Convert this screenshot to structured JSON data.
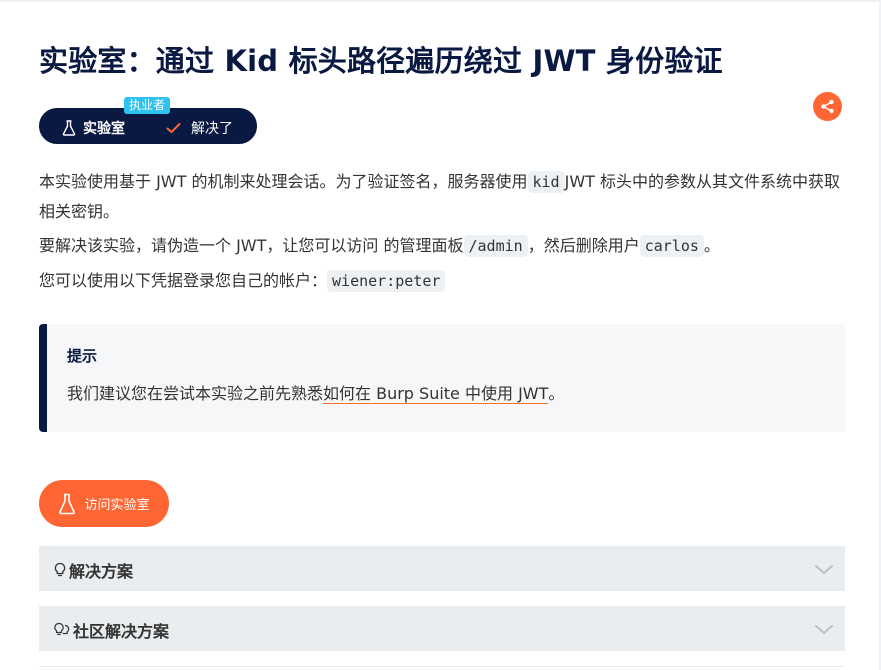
{
  "title": "实验室：通过 Kid 标头路径遍历绕过 JWT 身份验证",
  "status": {
    "tag": "执业者",
    "lab_label": "实验室",
    "solved_label": "解决了"
  },
  "description": {
    "p1_before": "本实验使用基于 JWT 的机制来处理会话。为了验证签名，服务器使用",
    "p1_code": "kid",
    "p1_after": "JWT 标头中的参数从其文件系统中获取相关密钥。",
    "p2_before": "要解决该实验，请伪造一个 JWT，让您可以访问 的管理面板",
    "p2_code1": "/admin",
    "p2_mid": "，然后删除用户",
    "p2_code2": "carlos",
    "p2_after": "。",
    "p3_before": "您可以使用以下凭据登录您自己的帐户：",
    "p3_code": "wiener:peter"
  },
  "hint": {
    "title": "提示",
    "text_before": "我们建议您在尝试本实验之前先熟悉",
    "link": "如何在 Burp Suite 中使用 JWT",
    "text_after": "。"
  },
  "access_button": "访问实验室",
  "accordions": [
    {
      "label": "解决方案",
      "icon": "lightbulb-icon"
    },
    {
      "label": "社区解决方案",
      "icon": "lightbulbs-icon"
    }
  ],
  "colors": {
    "navy": "#0a1941",
    "orange": "#ff6633",
    "cyan": "#2ec2ee",
    "panel": "#e9edf0"
  }
}
